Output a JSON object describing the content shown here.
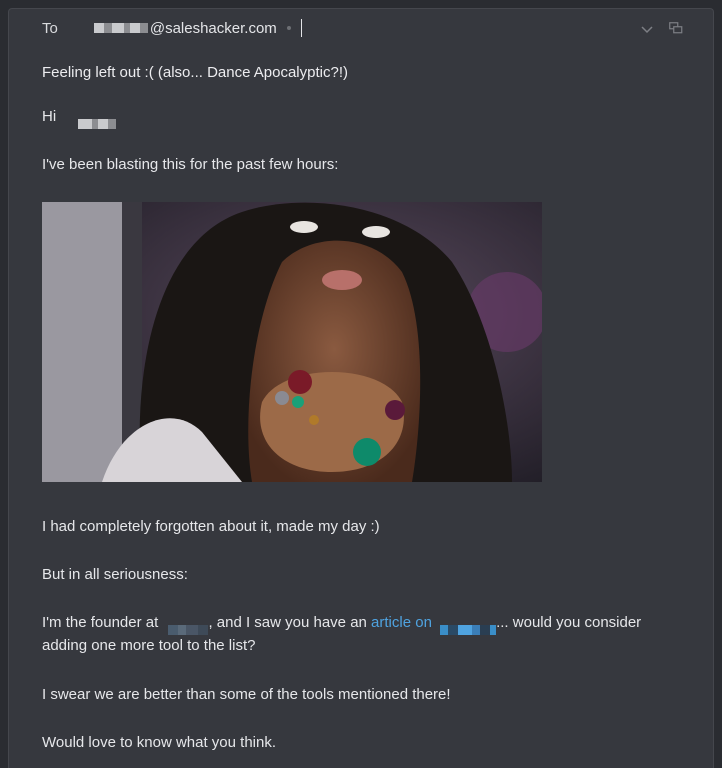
{
  "compose": {
    "to_label": "To",
    "to_domain": "@saleshacker.com",
    "subject": "Feeling left out :( (also... Dance Apocalyptic?!)",
    "greeting": "Hi",
    "line1": "I've been blasting this for the past few hours:",
    "line2": "I had completely forgotten about it, made my day :)",
    "line3": "But in all seriousness:",
    "line4_a": "I'm the founder at",
    "line4_b": ", and I saw you have an",
    "line4_link": "article on",
    "line4_c": "... would you consider",
    "line4_d": "adding one more tool to the list?",
    "line5": "I swear we are better than some of the tools mentioned there!",
    "line6": "Would love to know what you think."
  },
  "icons": {
    "expand": "chevron-down-icon",
    "popout": "popout-icon"
  },
  "colors": {
    "background": "#36383e",
    "text": "#e6e7ea",
    "link": "#4fa3e0"
  }
}
